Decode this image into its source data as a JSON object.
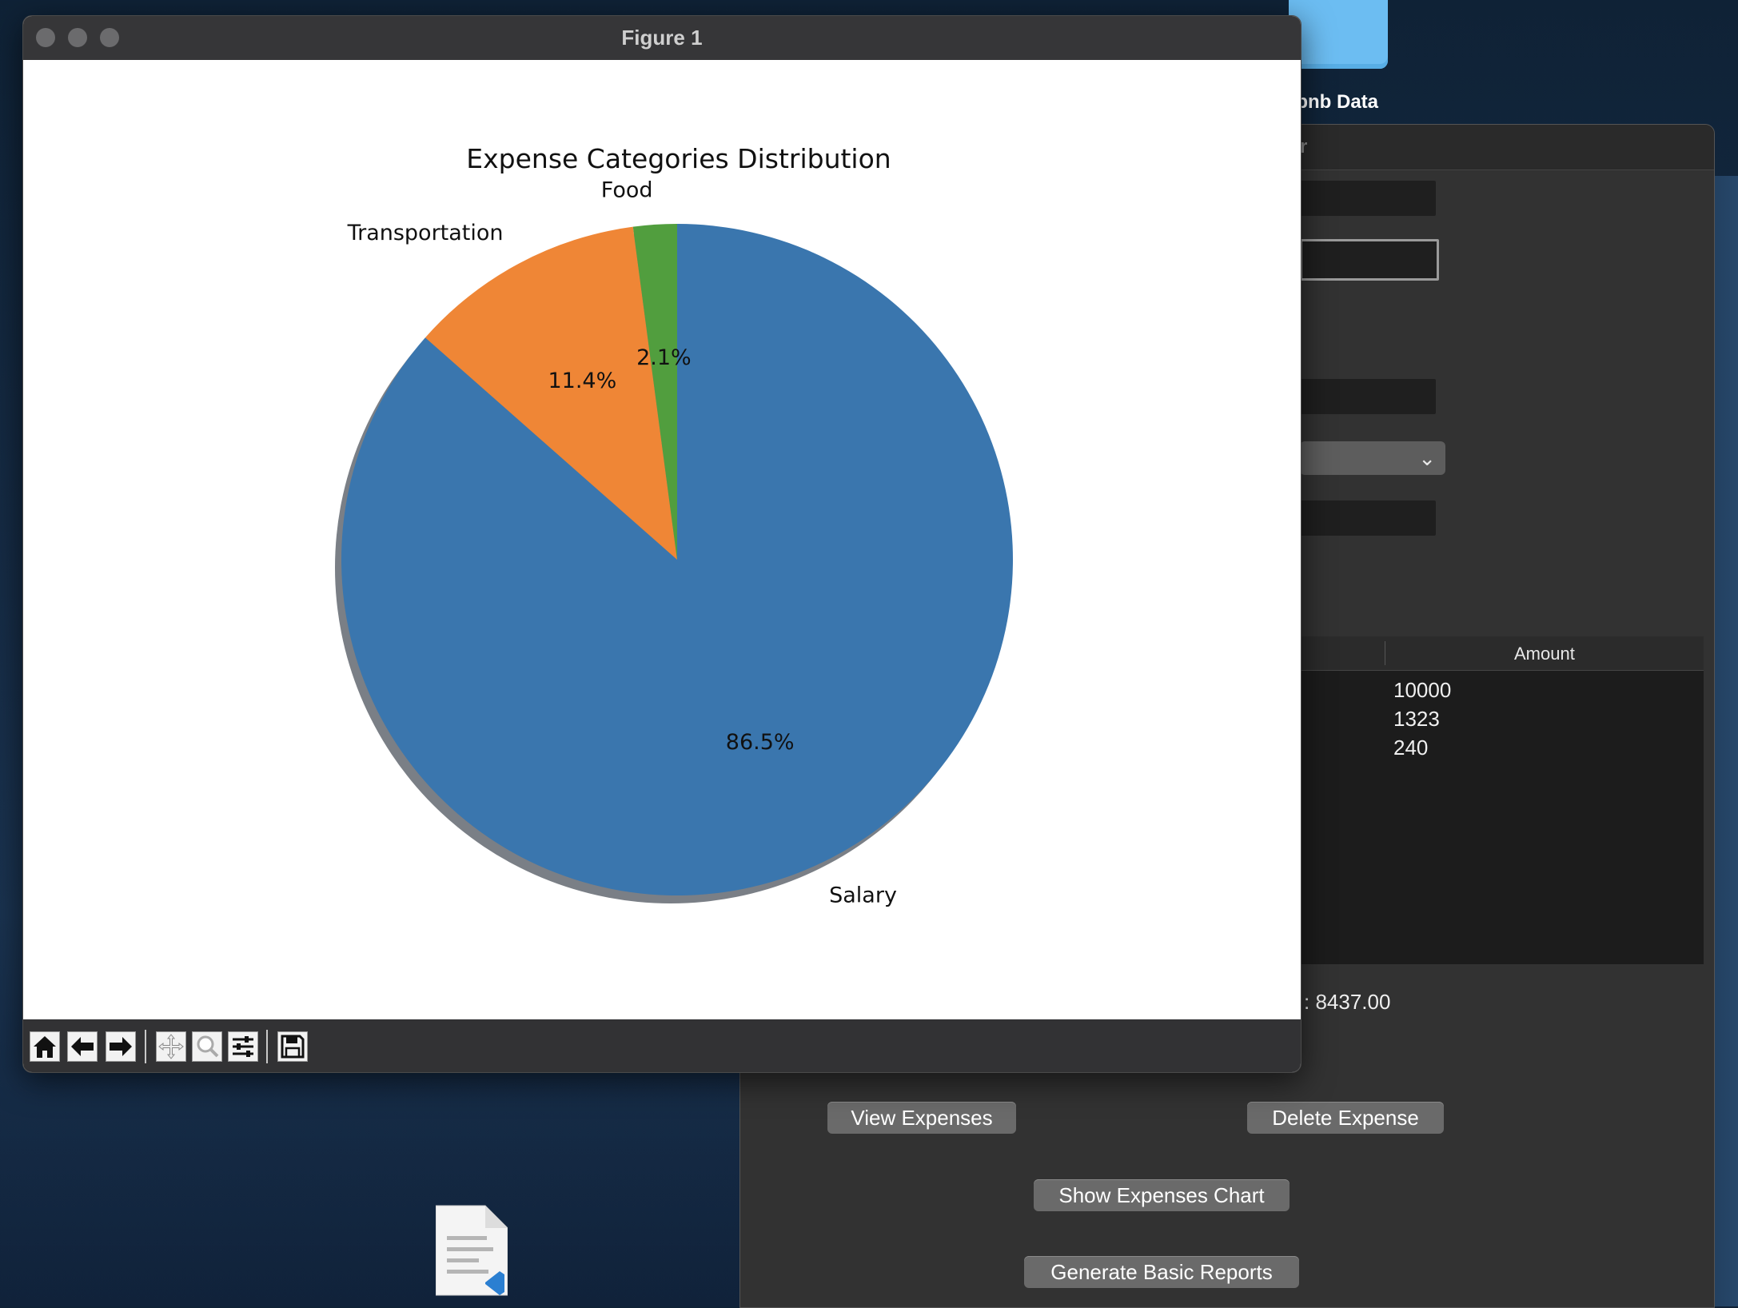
{
  "desktop": {
    "folder_label": "rbnb Data"
  },
  "app": {
    "title_fragment": "r",
    "table": {
      "amount_header": "Amount",
      "amounts": [
        "10000",
        "1323",
        "240"
      ]
    },
    "summary_text": ": 8437.00",
    "buttons": {
      "view": "View Expenses",
      "delete": "Delete Expense",
      "chart": "Show Expenses Chart",
      "reports": "Generate Basic Reports"
    }
  },
  "figure": {
    "window_title": "Figure 1",
    "toolbar": [
      "home-icon",
      "back-icon",
      "forward-icon",
      "pan-icon",
      "zoom-icon",
      "configure-subplots-icon",
      "save-icon"
    ]
  },
  "chart_data": {
    "type": "pie",
    "title": "Expense Categories Distribution",
    "labels": [
      "Salary",
      "Transportation",
      "Food"
    ],
    "values": [
      86.5,
      11.4,
      2.1
    ],
    "pct_labels": [
      "86.5%",
      "11.4%",
      "2.1%"
    ],
    "colors": [
      "#3a76ae",
      "#ef8636",
      "#519e3e"
    ],
    "shadow": true,
    "start_angle_deg": 90,
    "direction": "clockwise"
  }
}
